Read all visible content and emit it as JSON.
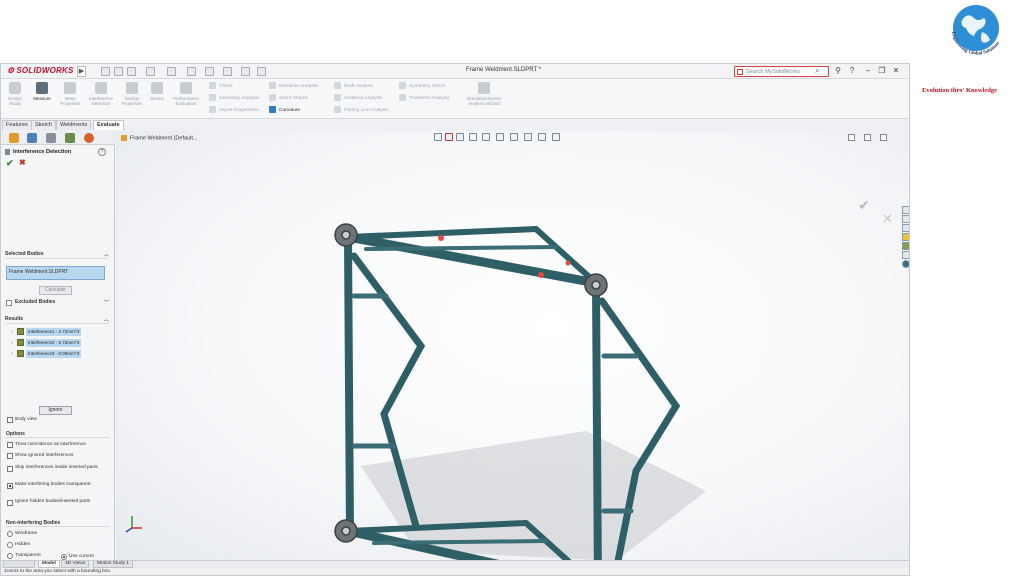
{
  "app": {
    "brand": "SOLIDWORKS",
    "document_title": "Frame Weldment.SLDPRT *",
    "search_placeholder": "Search MySolidWorks"
  },
  "command_manager": {
    "left": [
      {
        "label": "Design Study"
      },
      {
        "label": "Measure"
      },
      {
        "label": "Mass Properties"
      },
      {
        "label": "Interference Detection"
      },
      {
        "label": "Section Properties"
      },
      {
        "label": "Sensor"
      },
      {
        "label": "Performance Evaluation"
      }
    ],
    "right": [
      {
        "label": "Check"
      },
      {
        "label": "Geometry Analysis"
      },
      {
        "label": "Import Diagnostics"
      },
      {
        "label": "Deviation Analysis"
      },
      {
        "label": "Zebra Stripes"
      },
      {
        "label": "Curvature"
      },
      {
        "label": "Draft Analysis"
      },
      {
        "label": "Undercut Analysis"
      },
      {
        "label": "Parting Line Analysis"
      },
      {
        "label": "Symmetry Check"
      },
      {
        "label": "Thickness Analysis"
      },
      {
        "label": "SimulationXpress Analysis Wizard"
      }
    ]
  },
  "tabs": [
    "Features",
    "Sketch",
    "Weldments",
    "Evaluate"
  ],
  "property_manager": {
    "title": "Interference Detection",
    "help": "?",
    "ok": "✔",
    "cancel": "✖",
    "selected_bodies_label": "Selected Bodies",
    "selected_body": "Frame Weldment.SLDPRT",
    "calculate_label": "Calculate",
    "excluded_bodies_label": "Excluded Bodies",
    "results_label": "Results",
    "results": [
      {
        "label": "Interference1 - 2.72mm^3"
      },
      {
        "label": "Interference2 - 2.72mm^3"
      },
      {
        "label": "Interference3 - 0.00mm^3"
      }
    ],
    "ignore_label": "Ignore",
    "body_view_label": "Body view",
    "options_label": "Options",
    "options": [
      {
        "label": "Treat coincidence as interference",
        "checked": false
      },
      {
        "label": "Show ignored interferences",
        "checked": false
      },
      {
        "label": "Skip interferences inside inserted parts",
        "checked": false
      },
      {
        "label": "Make interfering bodies transparent",
        "checked": true
      },
      {
        "label": "Ignore hidden bodies/inserted parts",
        "checked": false
      }
    ],
    "non_interfering_label": "Non-interfering Bodies",
    "non_interfering": [
      {
        "label": "Wireframe",
        "checked": false
      },
      {
        "label": "Hidden",
        "checked": false
      },
      {
        "label": "Transparent",
        "checked": false
      },
      {
        "label": "Use current",
        "checked": true
      }
    ]
  },
  "viewport": {
    "breadcrumb": "Frame Weldment (Default..."
  },
  "bottom_tabs": [
    "Model",
    "3D Views",
    "Motion Study 1"
  ],
  "status_text": "Zooms to the area you select with a bounding box.",
  "branding": {
    "globe_text": "Engineering Global Solutions",
    "tagline": "Evolution thro' Knowledge"
  },
  "colors": {
    "frame": "#2f5f66",
    "highlight_box": "#e41b1b",
    "brand_red": "#c0151b",
    "selection": "#b9d7ef"
  }
}
